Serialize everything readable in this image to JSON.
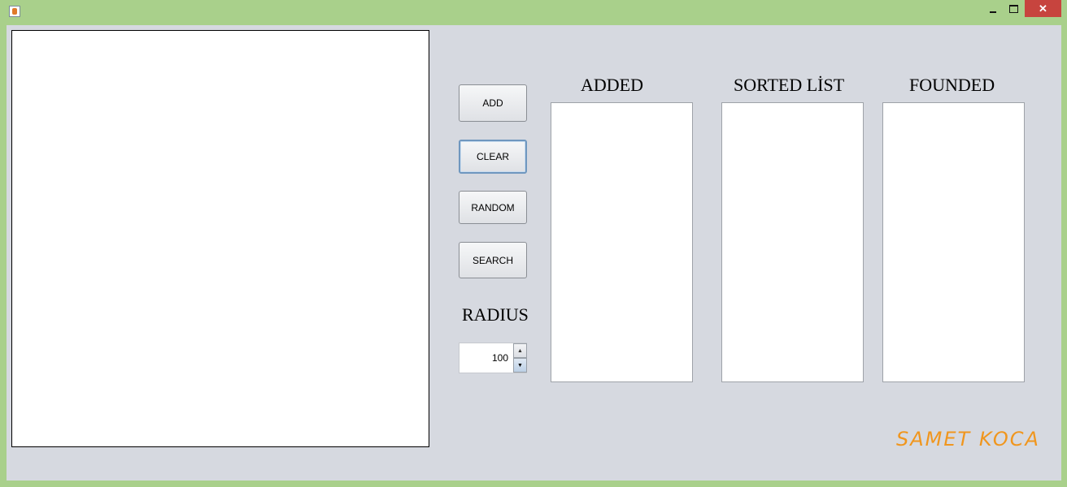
{
  "window": {
    "icon": "java-cup-icon",
    "controls": {
      "minimize": "minimize-icon",
      "maximize": "maximize-icon",
      "close": "close-icon"
    }
  },
  "buttons": {
    "add": "ADD",
    "clear": "CLEAR",
    "random": "RANDOM",
    "search": "SEARCH"
  },
  "radius": {
    "label": "RADIUS",
    "value": "100"
  },
  "lists": {
    "added": "ADDED",
    "sorted": "SORTED LİST",
    "founded": "FOUNDED"
  },
  "signature": "SAMET KOCA",
  "colors": {
    "frame": "#a9d08b",
    "panel": "#d6d9e0",
    "close_button": "#c7443e",
    "signature": "#f0961e"
  }
}
